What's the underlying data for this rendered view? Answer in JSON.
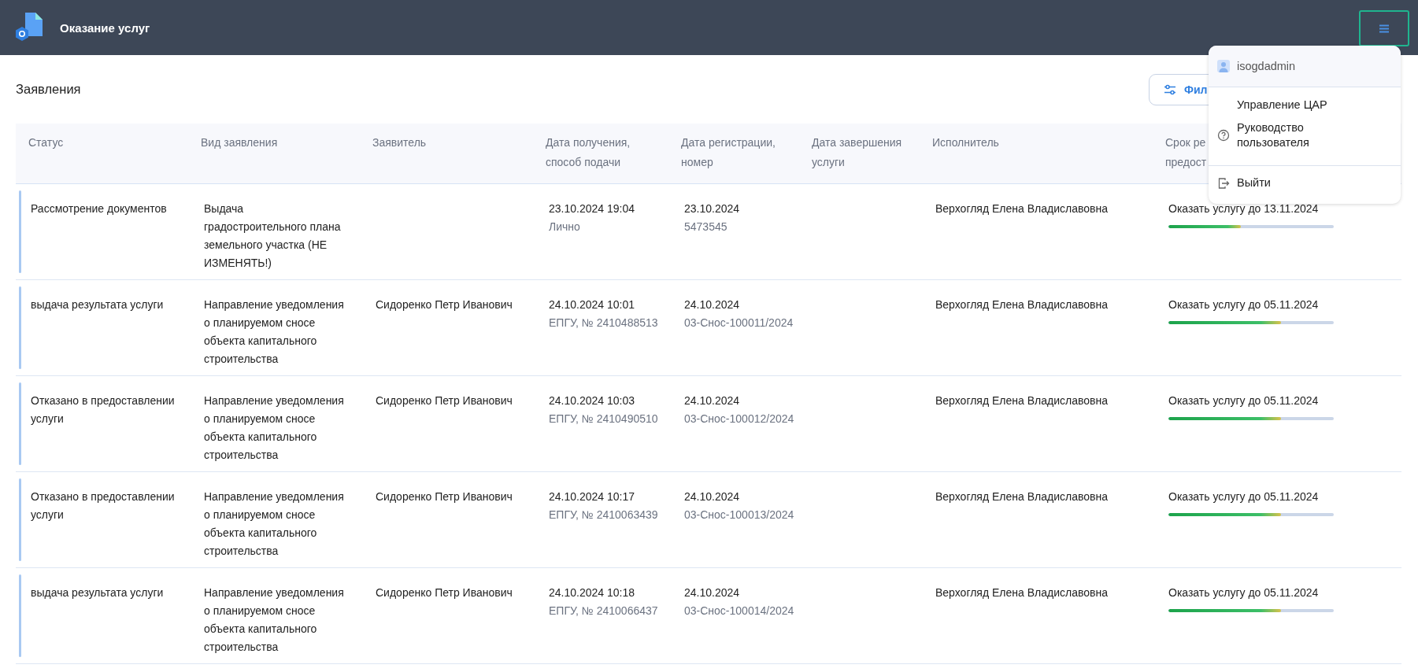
{
  "app": {
    "title": "Оказание услуг"
  },
  "page": {
    "title": "Заявления",
    "filter_button": "Фил"
  },
  "table": {
    "columns": [
      {
        "lines": [
          "Статус"
        ]
      },
      {
        "lines": [
          "Вид заявления"
        ]
      },
      {
        "lines": [
          "Заявитель"
        ]
      },
      {
        "lines": [
          "Дата получения,",
          "способ подачи"
        ]
      },
      {
        "lines": [
          "Дата регистрации,",
          "номер"
        ]
      },
      {
        "lines": [
          "Дата завершения",
          "услуги"
        ]
      },
      {
        "lines": [
          "Исполнитель"
        ]
      },
      {
        "lines": [
          "Срок ре",
          "предост"
        ]
      }
    ],
    "rows": [
      {
        "status": "Рассмотрение документов",
        "type": "Выдача градостроительного плана земельного участка (НЕ ИЗМЕНЯТЬ!)",
        "received": "23.10.2024 19:04",
        "method": "Лично",
        "registered": "23.10.2024",
        "number": "5473545",
        "performer": "Верхогляд Елена Владиславовна",
        "deadline": "Оказать услугу до 13.11.2024",
        "level": 0.44
      },
      {
        "status": "выдача результата услуги",
        "type": "Направление уведомления о планируемом сносе объекта капитального строительства",
        "applicant": "Сидоренко Петр Иванович",
        "received": "24.10.2024 10:01",
        "method": "ЕПГУ, № 2410488513",
        "registered": "24.10.2024",
        "number": "03-Снос-100011/2024",
        "performer": "Верхогляд Елена Владиславовна",
        "deadline": "Оказать услугу до 05.11.2024",
        "level": 0.68
      },
      {
        "status": "Отказано в предоставлении услуги",
        "type": "Направление уведомления о планируемом сносе объекта капитального строительства",
        "applicant": "Сидоренко Петр Иванович",
        "received": "24.10.2024 10:03",
        "method": "ЕПГУ, № 2410490510",
        "registered": "24.10.2024",
        "number": "03-Снос-100012/2024",
        "performer": "Верхогляд Елена Владиславовна",
        "deadline": "Оказать услугу до 05.11.2024",
        "level": 0.68
      },
      {
        "status": "Отказано в предоставлении услуги",
        "type": "Направление уведомления о планируемом сносе объекта капитального строительства",
        "applicant": "Сидоренко Петр Иванович",
        "received": "24.10.2024 10:17",
        "method": "ЕПГУ, № 2410063439",
        "registered": "24.10.2024",
        "number": "03-Снос-100013/2024",
        "performer": "Верхогляд Елена Владиславовна",
        "deadline": "Оказать услугу до 05.11.2024",
        "level": 0.68
      },
      {
        "status": "выдача результата услуги",
        "type": "Направление уведомления о планируемом сносе объекта капитального строительства",
        "applicant": "Сидоренко Петр Иванович",
        "received": "24.10.2024 10:18",
        "method": "ЕПГУ, № 2410066437",
        "registered": "24.10.2024",
        "number": "03-Снос-100014/2024",
        "performer": "Верхогляд Елена Владиславовна",
        "deadline": "Оказать услугу до 05.11.2024",
        "level": 0.68
      }
    ]
  },
  "user_menu": {
    "expanded": true,
    "user": "isogdadmin",
    "items": [
      {
        "label": "Управление ЦАР",
        "kind": "plain"
      },
      {
        "label": "Руководство пользователя",
        "kind": "help"
      },
      {
        "label": "Выйти",
        "kind": "logout"
      }
    ]
  }
}
